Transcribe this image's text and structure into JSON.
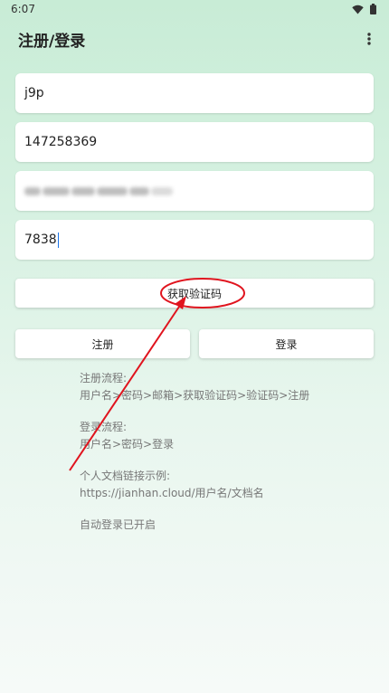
{
  "status_bar": {
    "time": "6:07"
  },
  "app_bar": {
    "title": "注册/登录"
  },
  "form": {
    "username_value": "j9p",
    "password_value": "147258369",
    "verification_code_value": "7838"
  },
  "buttons": {
    "get_code": "获取验证码",
    "register": "注册",
    "login": "登录"
  },
  "info": {
    "register_flow_title": "注册流程:",
    "register_flow_steps": "用户名>密码>邮箱>获取验证码>验证码>注册",
    "login_flow_title": "登录流程:",
    "login_flow_steps": "用户名>密码>登录",
    "doc_link_title": "个人文档链接示例:",
    "doc_link_example": "https://jianhan.cloud/用户名/文档名",
    "auto_login_status": "自动登录已开启"
  },
  "colors": {
    "annotation": "#e0141e",
    "caret": "#1a73e8"
  }
}
